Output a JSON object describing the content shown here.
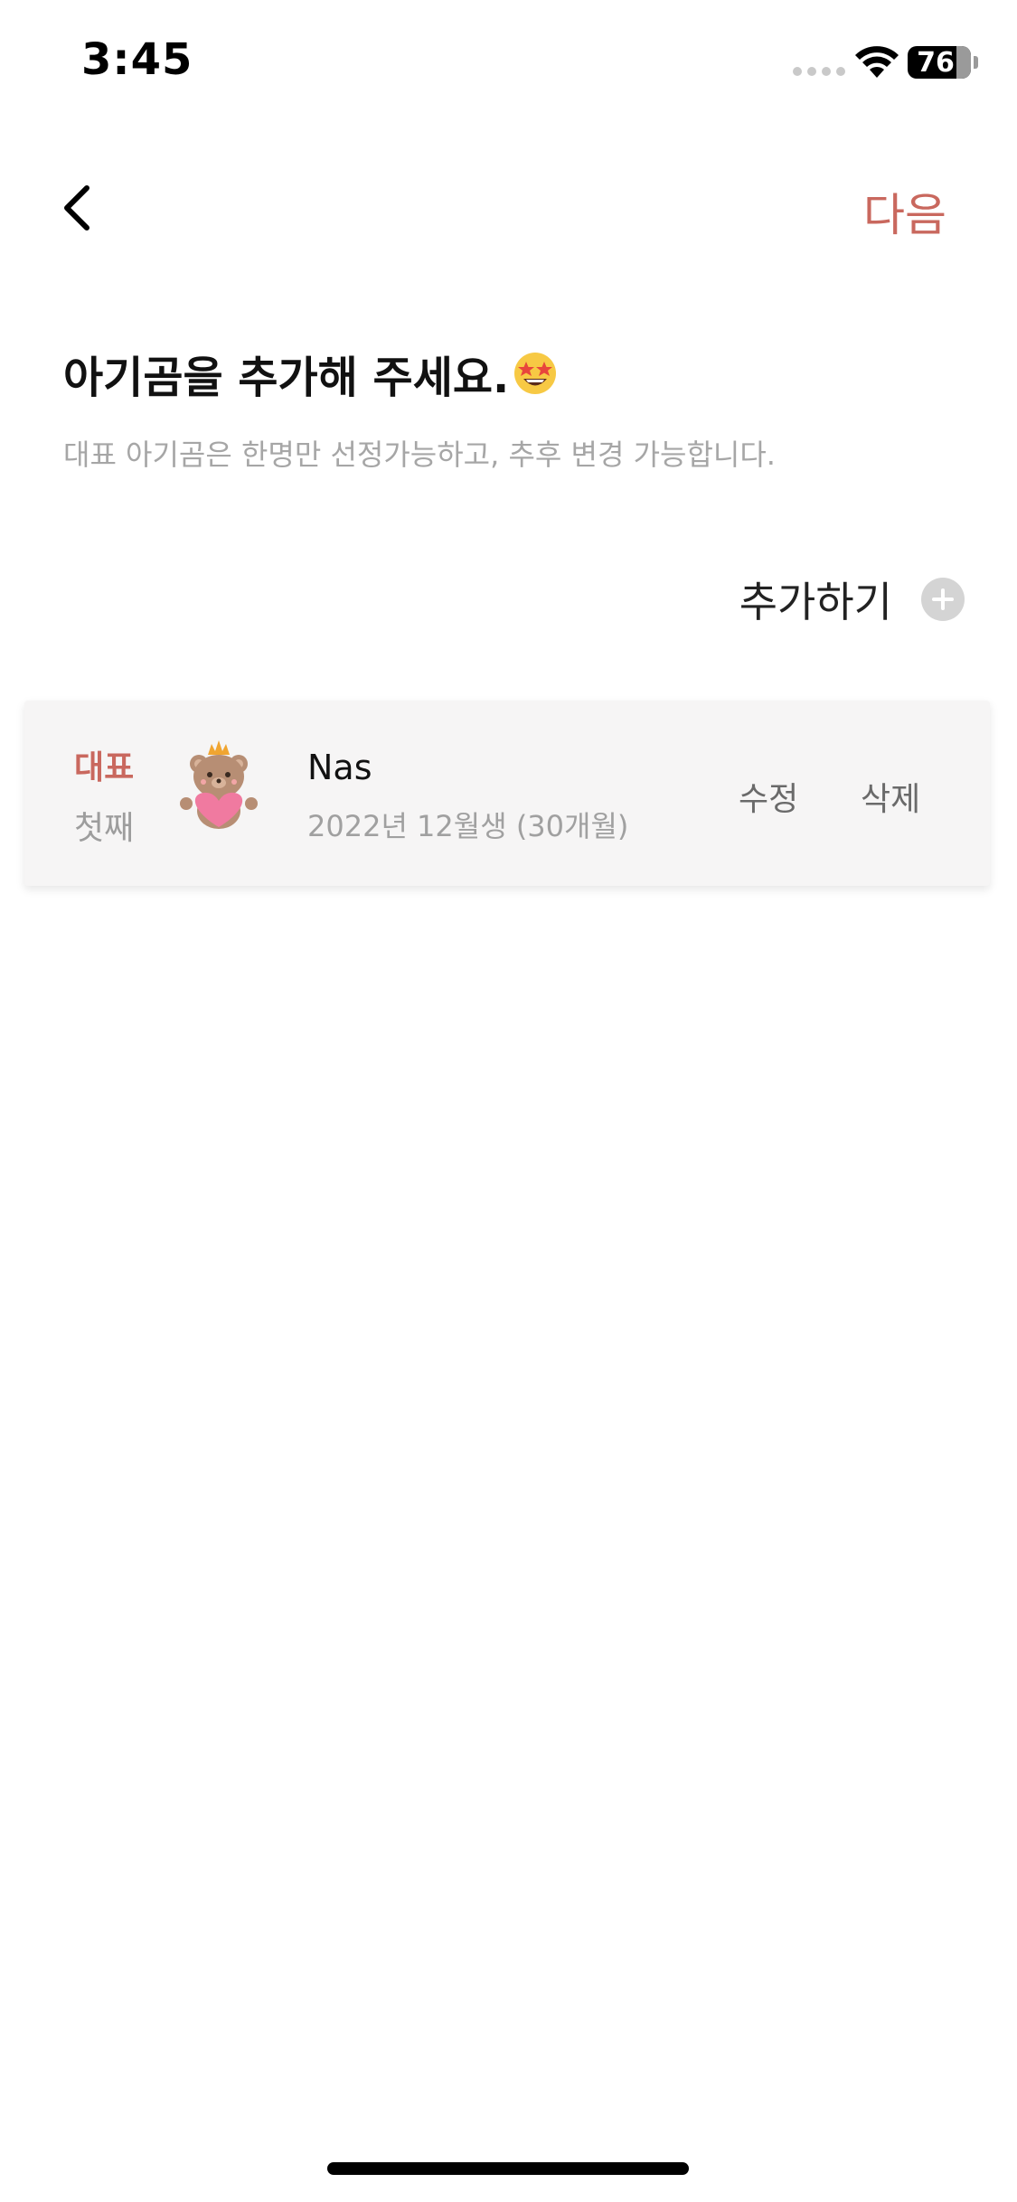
{
  "status_bar": {
    "time": "3:45",
    "battery": "76"
  },
  "nav": {
    "back_icon": "chevron-left-icon",
    "next_label": "다음"
  },
  "header": {
    "title": "아기곰을 추가해 주세요.",
    "title_emoji": "star-struck-emoji",
    "subtitle": "대표 아기곰은 한명만 선정가능하고, 추후 변경 가능합니다."
  },
  "add": {
    "label": "추가하기",
    "icon": "plus-circle-icon"
  },
  "babies": [
    {
      "badge": "대표",
      "order": "첫째",
      "avatar": "bear-with-heart-icon",
      "name": "Nas",
      "birth": "2022년 12월생 (30개월)",
      "edit_label": "수정",
      "delete_label": "삭제"
    }
  ],
  "colors": {
    "accent": "#c9685e",
    "muted": "#a6a6a6",
    "card_bg": "#f6f5f5"
  }
}
